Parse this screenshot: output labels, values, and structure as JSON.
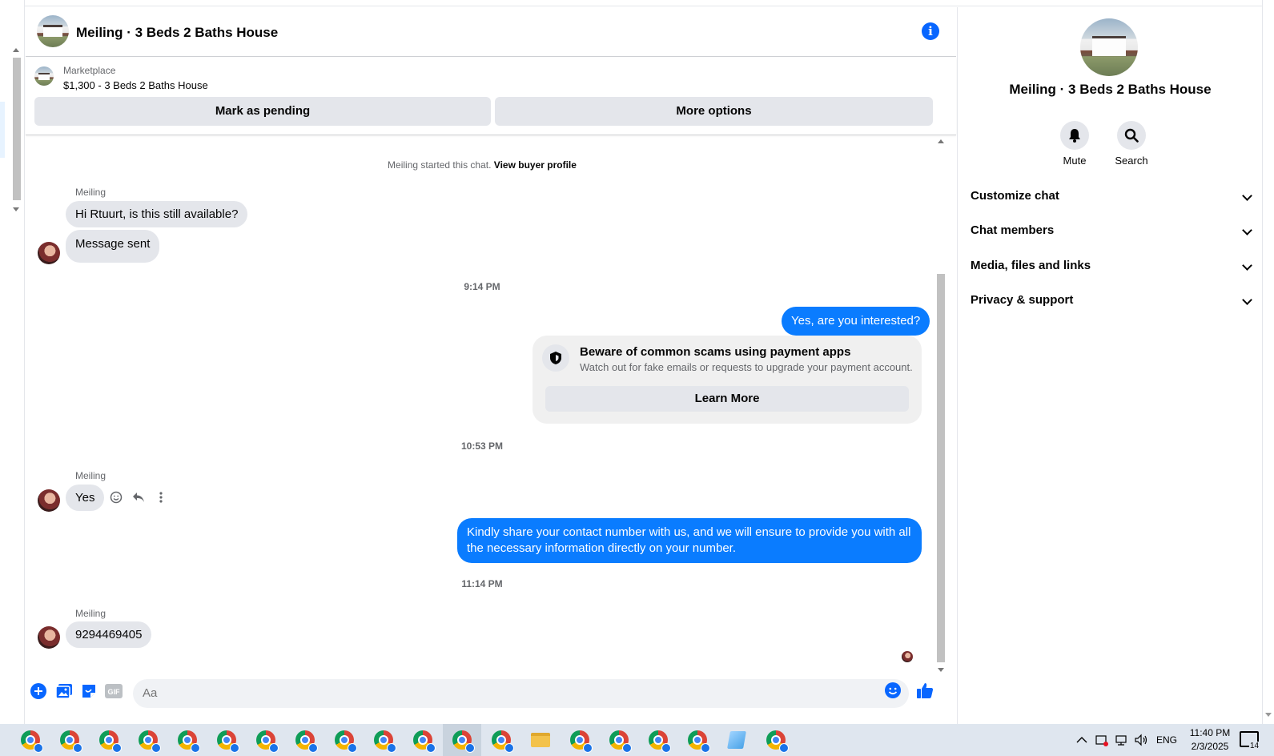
{
  "header": {
    "title": "Meiling · 3 Beds 2 Baths House"
  },
  "marketplace": {
    "label": "Marketplace",
    "listing": "$1,300 - 3 Beds 2 Baths House",
    "mark_pending": "Mark as pending",
    "more_options": "More options"
  },
  "chat": {
    "started_text": "Meiling started this chat.",
    "view_buyer": "View buyer profile",
    "sender_name": "Meiling",
    "msg1": "Hi Rtuurt, is this still available?",
    "msg2": "Message sent",
    "ts1": "9:14 PM",
    "out1": "Yes, are you interested?",
    "scam_title": "Beware of common scams using payment apps",
    "scam_body": "Watch out for fake emails or requests to upgrade your payment account.",
    "scam_learn": "Learn More",
    "ts2": "10:53 PM",
    "msg3": "Yes",
    "out2": "Kindly share your contact number with us, and we will ensure to provide you with all the necessary information directly on your number.",
    "ts3": "11:14 PM",
    "msg4": "9294469405"
  },
  "composer": {
    "placeholder": "Aa",
    "gif_label": "GIF"
  },
  "right_panel": {
    "title": "Meiling · 3 Beds 2 Baths House",
    "mute": "Mute",
    "search": "Search",
    "sections": [
      "Customize chat",
      "Chat members",
      "Media, files and links",
      "Privacy & support"
    ]
  },
  "taskbar": {
    "lang": "ENG",
    "time": "11:40 PM",
    "date": "2/3/2025",
    "notif_count": "14"
  },
  "colors": {
    "accent": "#0866ff",
    "out_bubble": "#0a7cff",
    "in_bubble": "#e4e6eb"
  },
  "icons": [
    "info-icon",
    "bell-icon",
    "search-icon",
    "chevron-down-icon",
    "plus-icon",
    "image-icon",
    "sticker-icon",
    "gif-icon",
    "emoji-icon",
    "like-icon",
    "shield-icon",
    "chrome-icon",
    "folder-icon"
  ]
}
